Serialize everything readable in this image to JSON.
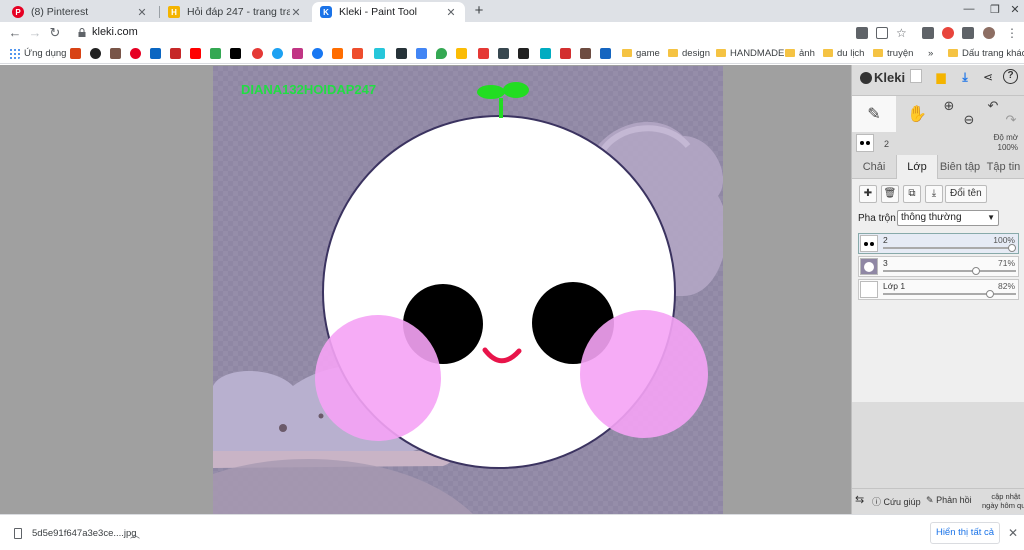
{
  "browser": {
    "tabs": [
      {
        "title": "(8) Pinterest",
        "icon": "pinterest-icon",
        "color": "#e60023",
        "glyph": "P"
      },
      {
        "title": "Hỏi đáp 247 - trang tra loi",
        "icon": "hoidap-icon",
        "color": "#f4b400",
        "glyph": "H"
      },
      {
        "title": "Kleki - Paint Tool",
        "icon": "kleki-icon",
        "color": "#1a73e8",
        "glyph": "K"
      }
    ],
    "url": "kleki.com",
    "bookmarks": {
      "apps_label": "Ứng dụng",
      "folders": [
        "game",
        "design",
        "HANDMADE",
        "ảnh",
        "du lịch",
        "truyện"
      ],
      "other": "Dấu trang khác",
      "more": "»"
    }
  },
  "canvas": {
    "watermark": "DIANA132HOIDAP247"
  },
  "panel": {
    "logo": "Kleki",
    "current_layer": "2",
    "opacity_label_line1": "Độ mờ",
    "opacity_label_line2": "100%",
    "tabs": [
      "Chải",
      "Lớp",
      "Biên tập",
      "Tập tin"
    ],
    "active_tab": "Lớp",
    "rename": "Đổi tên",
    "blend_label": "Pha trộn",
    "blend_value": "thông thường",
    "layers": [
      {
        "name": "2",
        "opacity": "100%",
        "level": 1.0
      },
      {
        "name": "3",
        "opacity": "71%",
        "level": 0.71
      },
      {
        "name": "Lớp 1",
        "opacity": "82%",
        "level": 0.82
      }
    ],
    "bottom": {
      "help": "Cứu giúp",
      "feedback": "Phản hồi",
      "update_line1": "cập nhật",
      "update_line2": "ngày hôm qua"
    }
  },
  "downloads": {
    "file": "5d5e91f647a3e3ce....jpg",
    "show_all": "Hiển thị tất cả"
  },
  "colors": {
    "canvas_bg": "#8f87a4",
    "watermark": "#22dd44",
    "blush": "#f5a3f5",
    "sprout": "#22dd22",
    "mouth": "#e8144a"
  }
}
